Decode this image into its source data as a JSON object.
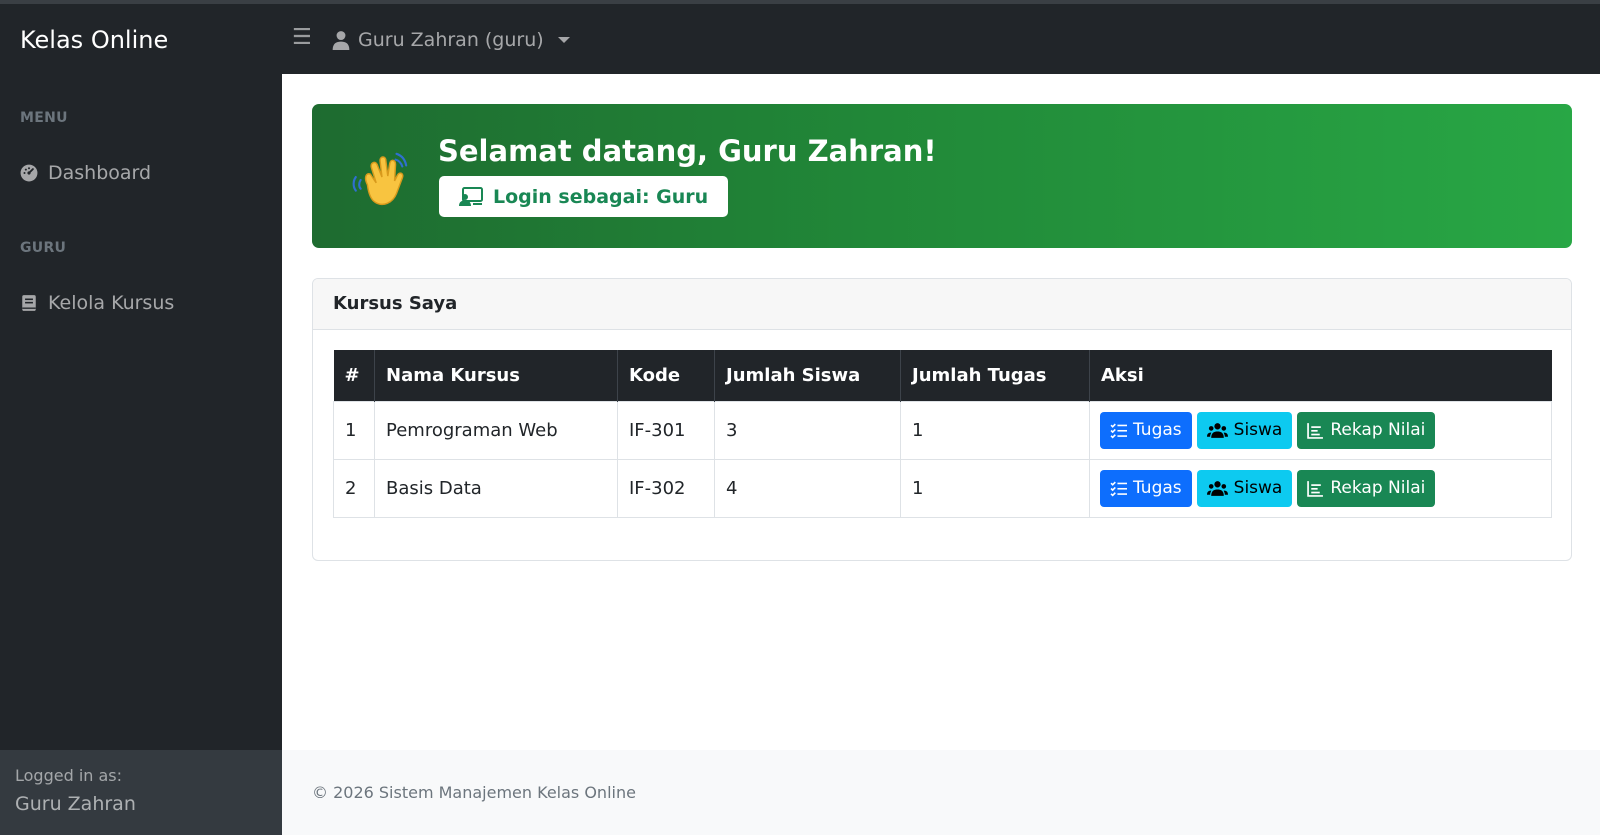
{
  "app": {
    "brand": "Kelas Online"
  },
  "sidebar": {
    "sections": [
      {
        "heading": "MENU",
        "items": [
          {
            "label": "Dashboard",
            "icon": "speedometer-icon"
          }
        ]
      },
      {
        "heading": "GURU",
        "items": [
          {
            "label": "Kelola Kursus",
            "icon": "book-icon"
          }
        ]
      }
    ],
    "footer": {
      "label": "Logged in as:",
      "user": "Guru Zahran"
    }
  },
  "navbar": {
    "menu_icon": "hamburger-icon",
    "user_label": "Guru Zahran (guru)",
    "user_icon": "person-icon"
  },
  "welcome": {
    "title": "Selamat datang, Guru Zahran!",
    "role_badge": "Login sebagai: Guru",
    "emoji": "waving-hand",
    "badge_icon": "person-video-icon"
  },
  "courses": {
    "title": "Kursus Saya",
    "columns": [
      "#",
      "Nama Kursus",
      "Kode",
      "Jumlah Siswa",
      "Jumlah Tugas",
      "Aksi"
    ],
    "rows": [
      {
        "no": "1",
        "name": "Pemrograman Web",
        "code": "IF-301",
        "students": "3",
        "tasks": "1"
      },
      {
        "no": "2",
        "name": "Basis Data",
        "code": "IF-302",
        "students": "4",
        "tasks": "1"
      }
    ],
    "actions": {
      "tasks": "Tugas",
      "students": "Siswa",
      "grades": "Rekap Nilai"
    }
  },
  "footer": {
    "text": "© 2026 Sistem Manajemen Kelas Online"
  },
  "colors": {
    "sidebar": "#212529",
    "primary": "#0d6efd",
    "info": "#0dcaf0",
    "success": "#198754",
    "banner_start": "#1e6b30",
    "banner_end": "#28a745"
  }
}
